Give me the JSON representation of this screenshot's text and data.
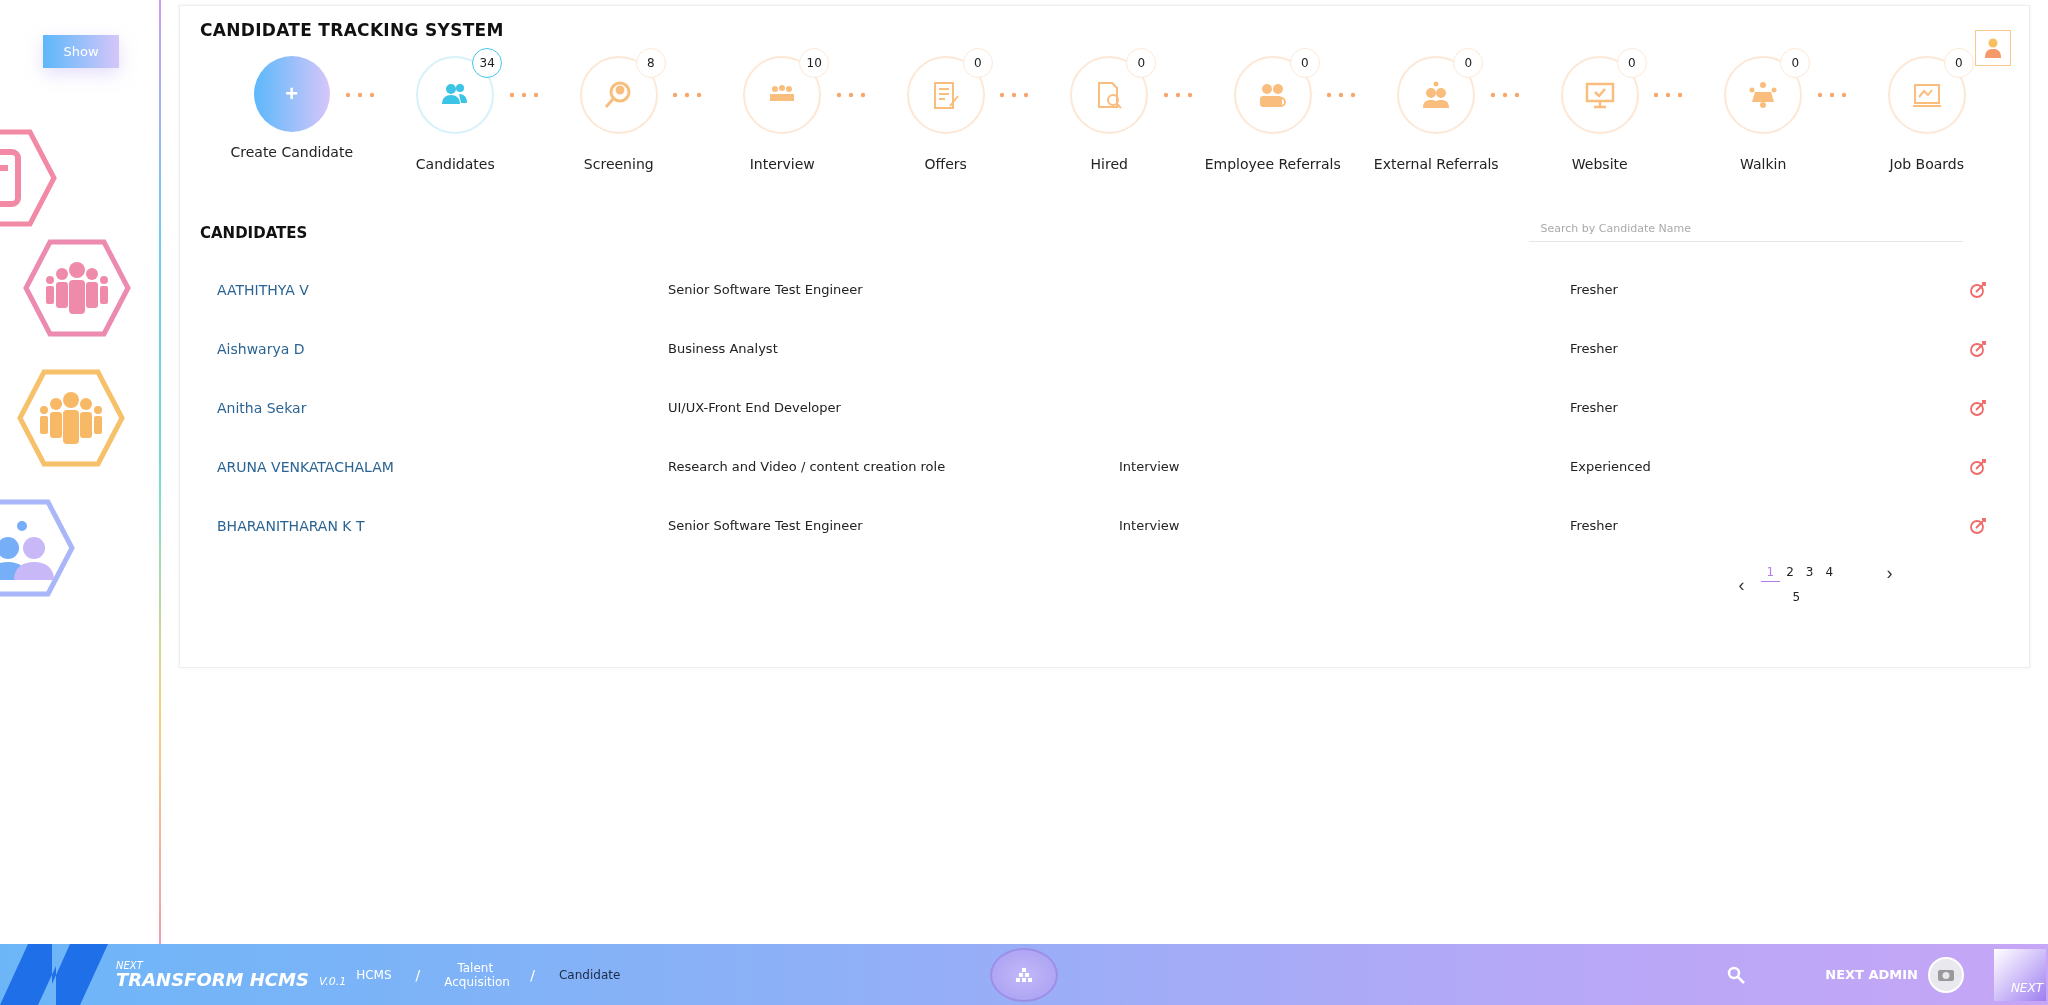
{
  "sidebar": {
    "show_button": "Show"
  },
  "title": "CANDIDATE TRACKING SYSTEM",
  "stages": [
    {
      "kind": "create",
      "label": "Create Candidate",
      "icon": "+"
    },
    {
      "kind": "stage",
      "label": "Candidates",
      "count": "34",
      "selected": true
    },
    {
      "kind": "stage",
      "label": "Screening",
      "count": "8",
      "selected": false
    },
    {
      "kind": "stage",
      "label": "Interview",
      "count": "10",
      "selected": false
    },
    {
      "kind": "stage",
      "label": "Offers",
      "count": "0",
      "selected": false
    },
    {
      "kind": "stage",
      "label": "Hired",
      "count": "0",
      "selected": false
    },
    {
      "kind": "stage",
      "label": "Employee Referrals",
      "count": "0",
      "selected": false
    },
    {
      "kind": "stage",
      "label": "External Referrals",
      "count": "0",
      "selected": false
    },
    {
      "kind": "stage",
      "label": "Website",
      "count": "0",
      "selected": false
    },
    {
      "kind": "stage",
      "label": "Walkin",
      "count": "0",
      "selected": false
    },
    {
      "kind": "stage",
      "label": "Job Boards",
      "count": "0",
      "selected": false
    }
  ],
  "candidates": {
    "heading": "CANDIDATES",
    "search": {
      "placeholder": "Search by Candidate Name"
    },
    "rows": [
      {
        "name": "AATHITHYA V",
        "role": "Senior Software Test Engineer",
        "status": "",
        "experience": "Fresher"
      },
      {
        "name": "Aishwarya D",
        "role": "Business Analyst",
        "status": "",
        "experience": "Fresher"
      },
      {
        "name": "Anitha Sekar",
        "role": "UI/UX-Front End Developer",
        "status": "",
        "experience": "Fresher"
      },
      {
        "name": "ARUNA VENKATACHALAM",
        "role": "Research and Video / content creation role",
        "status": "Interview",
        "experience": "Experienced"
      },
      {
        "name": "BHARANITHARAN K T",
        "role": "Senior Software Test Engineer",
        "status": "Interview",
        "experience": "Fresher"
      }
    ],
    "pagination": {
      "prev": "‹",
      "next": "›",
      "pages": [
        {
          "label": "1",
          "selected": true
        },
        {
          "label": "2",
          "selected": false
        },
        {
          "label": "3",
          "selected": false
        },
        {
          "label": "4",
          "selected": false
        },
        {
          "label": "5",
          "selected": false
        }
      ]
    }
  },
  "footer": {
    "brand_top": "NEXT",
    "brand": "TRANSFORM HCMS",
    "version": "V.0.1",
    "breadcrumbs": [
      "HCMS",
      "Talent Acquisition",
      "Candidate"
    ],
    "separator": "/",
    "user": "NEXT ADMIN",
    "corner": "NEXT"
  }
}
